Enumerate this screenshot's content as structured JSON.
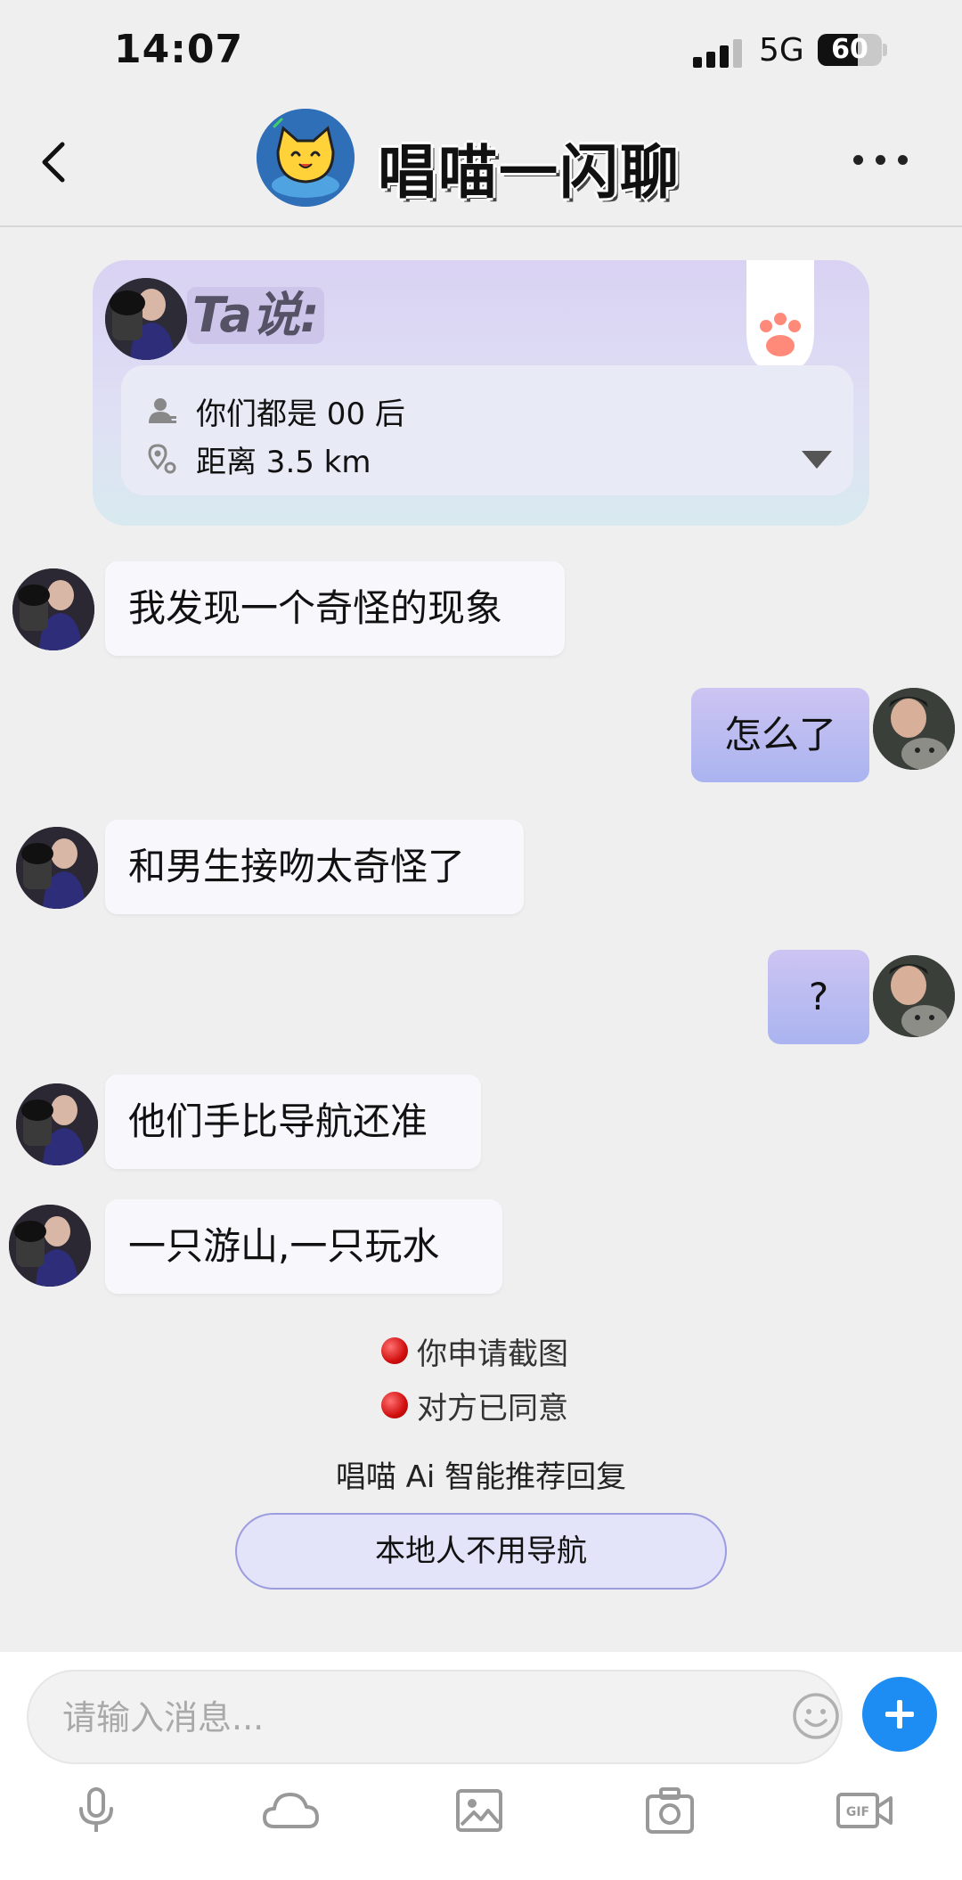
{
  "status_bar": {
    "time": "14:07",
    "network": "5G",
    "battery": "60"
  },
  "header": {
    "title": "唱喵一闪聊"
  },
  "info_card": {
    "heading": "Ta说:",
    "rows": [
      {
        "icon": "person-icon",
        "text": "你们都是 00 后"
      },
      {
        "icon": "location-icon",
        "text": "距离 3.5 km"
      }
    ]
  },
  "messages": [
    {
      "from": "them",
      "text": "我发现一个奇怪的现象"
    },
    {
      "from": "me",
      "text": "怎么了"
    },
    {
      "from": "them",
      "text": "和男生接吻太奇怪了"
    },
    {
      "from": "me",
      "text": "?"
    },
    {
      "from": "them",
      "text": "他们手比导航还准"
    },
    {
      "from": "them",
      "text": "一只游山,一只玩水"
    }
  ],
  "system_notices": [
    "你申请截图",
    "对方已同意"
  ],
  "ai": {
    "label": "唱喵 Ai 智能推荐回复",
    "suggestion": "本地人不用导航"
  },
  "input": {
    "placeholder": "请输入消息..."
  },
  "toolbar": [
    "microphone-icon",
    "cloud-icon",
    "image-icon",
    "camera-icon",
    "gif-video-icon"
  ],
  "colors": {
    "accent": "#1d8df3",
    "bubble_out": "#b9bcf2",
    "notice_dot": "#d10f0f"
  }
}
